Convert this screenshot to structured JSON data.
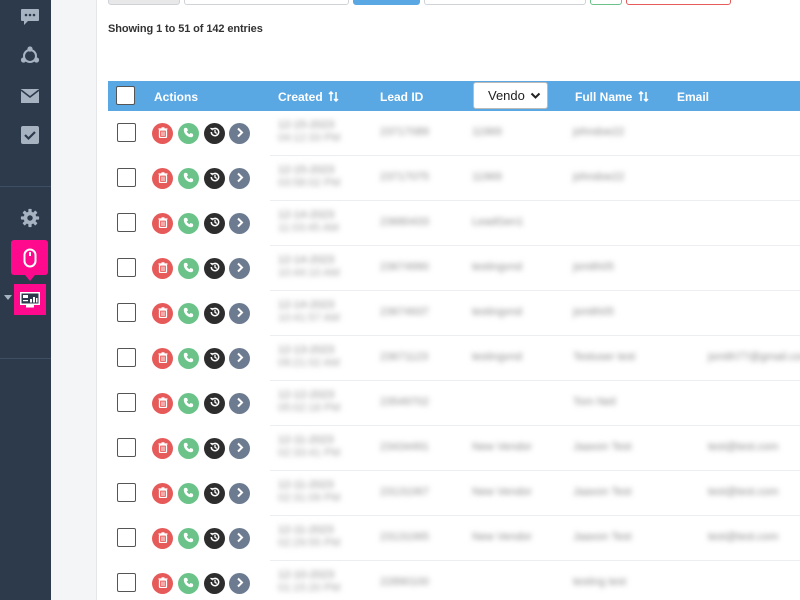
{
  "sidebar": {
    "icons": [
      {
        "name": "chat-icon"
      },
      {
        "name": "network-icon"
      },
      {
        "name": "mail-icon"
      },
      {
        "name": "checklist-icon"
      },
      {
        "name": "gear-icon"
      },
      {
        "name": "mouse-icon"
      },
      {
        "name": "monitor-dashboard-icon"
      }
    ],
    "active_color": "#ff0a8c",
    "background": "#2c3a4c"
  },
  "table_info": "Showing 1 to 51 of 142 entries",
  "table": {
    "header_color": "#5aa8e3",
    "columns": {
      "actions": "Actions",
      "created": "Created",
      "lead_id": "Lead ID",
      "vendor": "Vendo",
      "full_name": "Full Name",
      "email": "Email"
    },
    "rows": [
      {
        "created": [
          "12-15-2023",
          "04:12:33 PM"
        ],
        "lead_id": "23717089",
        "vendor": "11969",
        "full_name": "johndoe22",
        "email": ""
      },
      {
        "created": [
          "12-15-2023",
          "03:58:02 PM"
        ],
        "lead_id": "23717075",
        "vendor": "11969",
        "full_name": "johndoe22",
        "email": ""
      },
      {
        "created": [
          "12-14-2023",
          "11:03:45 AM"
        ],
        "lead_id": "23680433",
        "vendor": "LeadGen1",
        "full_name": "",
        "email": ""
      },
      {
        "created": [
          "12-14-2023",
          "10:44:10 AM"
        ],
        "lead_id": "23674990",
        "vendor": "testingvnd",
        "full_name": "jsmith05",
        "email": ""
      },
      {
        "created": [
          "12-14-2023",
          "10:41:57 AM"
        ],
        "lead_id": "23674937",
        "vendor": "testingvnd",
        "full_name": "jsmith05",
        "email": ""
      },
      {
        "created": [
          "12-13-2023",
          "09:21:02 AM"
        ],
        "lead_id": "23671123",
        "vendor": "testingvnd",
        "full_name": "Testuser test",
        "email": "jsmith77@gmail.com"
      },
      {
        "created": [
          "12-12-2023",
          "05:02:18 PM"
        ],
        "lead_id": "23549702",
        "vendor": "",
        "full_name": "Tom Neil",
        "email": ""
      },
      {
        "created": [
          "12-11-2023",
          "02:33:41 PM"
        ],
        "lead_id": "23434491",
        "vendor": "New Vendor",
        "full_name": "Jaaxon Test",
        "email": "test@test.com"
      },
      {
        "created": [
          "12-11-2023",
          "02:31:09 PM"
        ],
        "lead_id": "23131067",
        "vendor": "New Vendor",
        "full_name": "Jaaxon Test",
        "email": "test@test.com"
      },
      {
        "created": [
          "12-11-2023",
          "02:29:55 PM"
        ],
        "lead_id": "23131065",
        "vendor": "New Vendor",
        "full_name": "Jaaxon Test",
        "email": "test@test.com"
      },
      {
        "created": [
          "12-10-2023",
          "01:15:20 PM"
        ],
        "lead_id": "22890100",
        "vendor": "",
        "full_name": "testing test",
        "email": ""
      }
    ]
  }
}
